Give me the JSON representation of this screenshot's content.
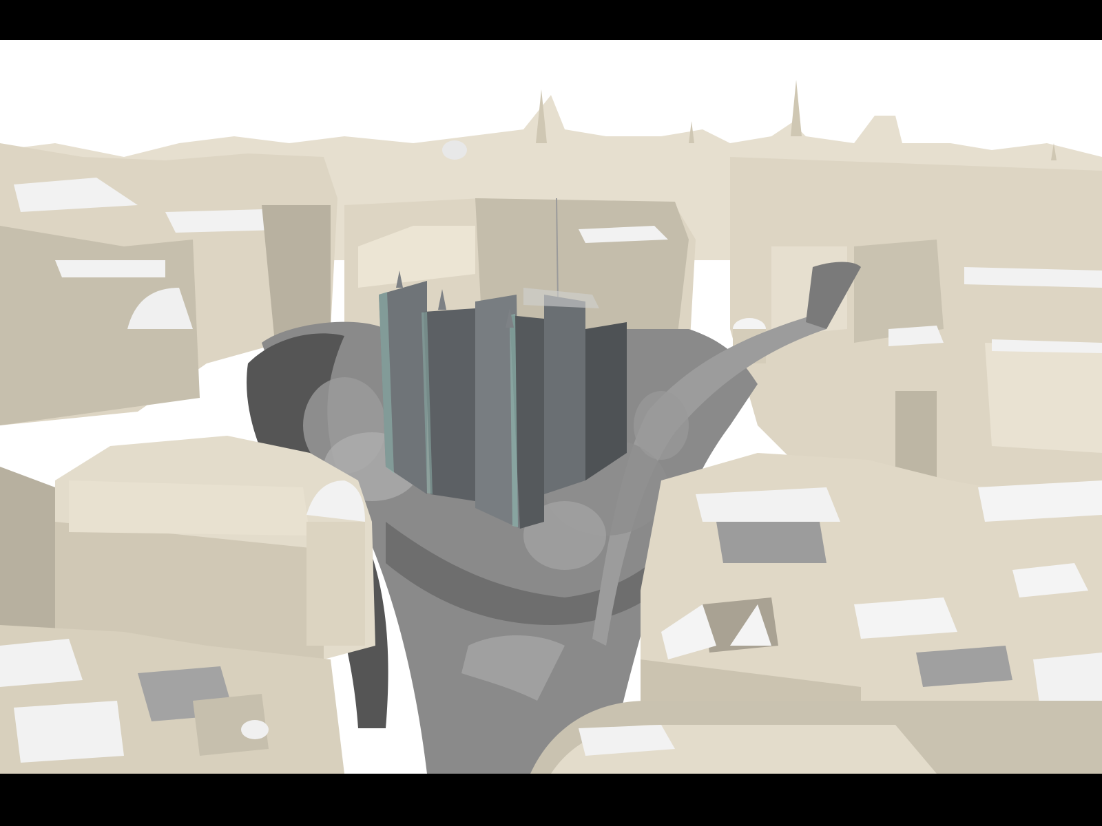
{
  "scene": {
    "subject": "",
    "colors": {
      "sky": "#ffffff",
      "building_light": "#e3dccb",
      "building_mid": "#d2cab6",
      "building_shade": "#a9a293",
      "roof_white": "#f4f4f4",
      "roof_grey": "#9a9a9a",
      "road": "#8a8a8a",
      "road_shadow": "#4a4a4a",
      "glass": "#6f7478",
      "glass_dark": "#55595c",
      "glass_edge": "#8fb5ae",
      "letterbox": "#000000"
    }
  }
}
